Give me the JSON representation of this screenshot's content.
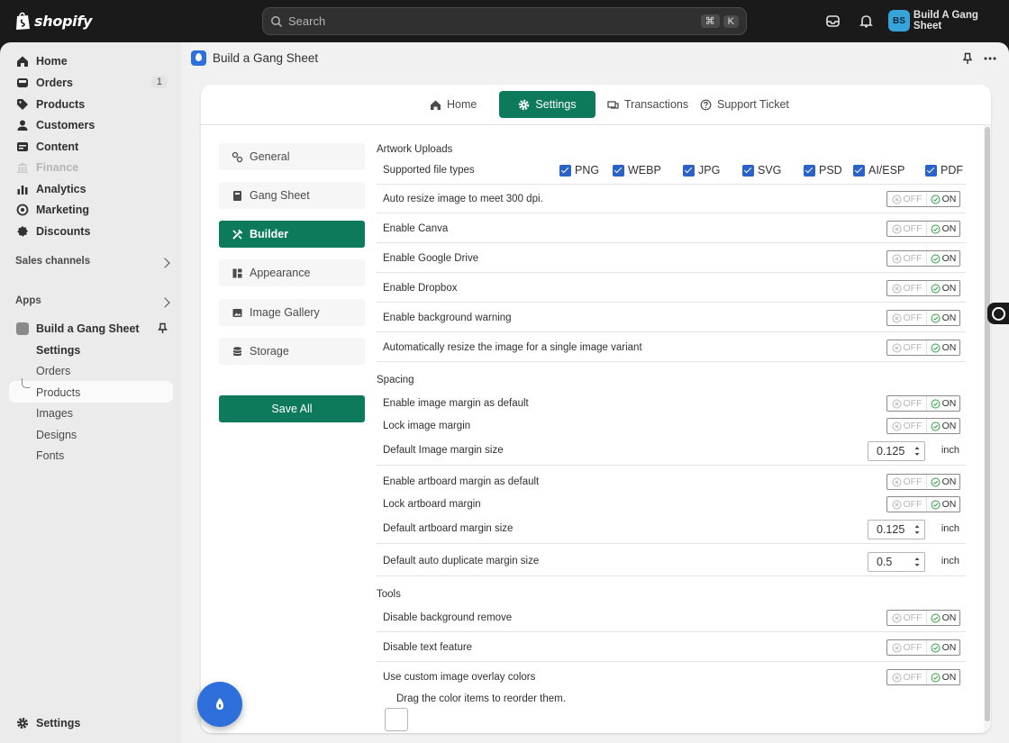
{
  "topbar": {
    "logo_text": "shopify",
    "search_placeholder": "Search",
    "kbd_cmd": "⌘",
    "kbd_k": "K",
    "store_initials": "BS",
    "store_name": "Build A Gang Sheet"
  },
  "sidebar": {
    "items": [
      {
        "label": "Home",
        "icon": "home-icon"
      },
      {
        "label": "Orders",
        "icon": "orders-icon",
        "badge": "1"
      },
      {
        "label": "Products",
        "icon": "tag-icon"
      },
      {
        "label": "Customers",
        "icon": "person-icon"
      },
      {
        "label": "Content",
        "icon": "content-icon"
      },
      {
        "label": "Finance",
        "icon": "bank-icon",
        "disabled": true
      },
      {
        "label": "Analytics",
        "icon": "analytics-icon"
      },
      {
        "label": "Marketing",
        "icon": "target-icon"
      },
      {
        "label": "Discounts",
        "icon": "discount-icon"
      }
    ],
    "sales_channels_label": "Sales channels",
    "apps_label": "Apps",
    "app_name": "Build a Gang Sheet",
    "app_sub_items": [
      "Settings",
      "Orders",
      "Products",
      "Images",
      "Designs",
      "Fonts"
    ],
    "settings_label": "Settings"
  },
  "main": {
    "app_title": "Build a Gang Sheet",
    "tabs": [
      {
        "label": "Home",
        "icon": "home-icon"
      },
      {
        "label": "Settings",
        "icon": "gear-icon",
        "active": true
      },
      {
        "label": "Transactions",
        "icon": "transactions-icon"
      },
      {
        "label": "Support Ticket",
        "icon": "help-icon"
      }
    ],
    "left_nav": [
      {
        "label": "General",
        "icon": "general-icon"
      },
      {
        "label": "Gang Sheet",
        "icon": "book-icon"
      },
      {
        "label": "Builder",
        "icon": "tools-icon",
        "active": true
      },
      {
        "label": "Appearance",
        "icon": "layout-icon"
      },
      {
        "label": "Image Gallery",
        "icon": "image-icon"
      },
      {
        "label": "Storage",
        "icon": "database-icon"
      }
    ],
    "save_all": "Save All"
  },
  "settings": {
    "artwork_title": "Artwork Uploads",
    "supported_label": "Supported file types",
    "file_types": [
      "PNG",
      "WEBP",
      "JPG",
      "SVG",
      "PSD",
      "AI/ESP",
      "PDF"
    ],
    "toggle_off": "OFF",
    "toggle_on": "ON",
    "artwork_rows": [
      "Auto resize image to meet 300 dpi.",
      "Enable Canva",
      "Enable Google Drive",
      "Enable Dropbox",
      "Enable background warning",
      "Automatically resize the image for a single image variant"
    ],
    "spacing_title": "Spacing",
    "spacing_rows": [
      "Enable image margin as default",
      "Lock image margin",
      "Default Image margin size",
      "Enable artboard margin as default",
      "Lock artboard margin",
      "Default artboard margin size",
      "Default auto duplicate margin size"
    ],
    "image_margin_value": "0.125",
    "artboard_margin_value": "0.125",
    "duplicate_margin_value": "0.5",
    "unit": "inch",
    "tools_title": "Tools",
    "tools_rows": [
      "Disable background remove",
      "Disable text feature",
      "Use custom image overlay colors"
    ],
    "drag_hint": "Drag the color items to reorder them."
  },
  "colors": {
    "primary": "#0e7a5c",
    "topbar": "#1a1a1a",
    "checkbox": "#2a62c9",
    "app_blue": "#2e6fdb",
    "on_check": "#2f9e44"
  }
}
